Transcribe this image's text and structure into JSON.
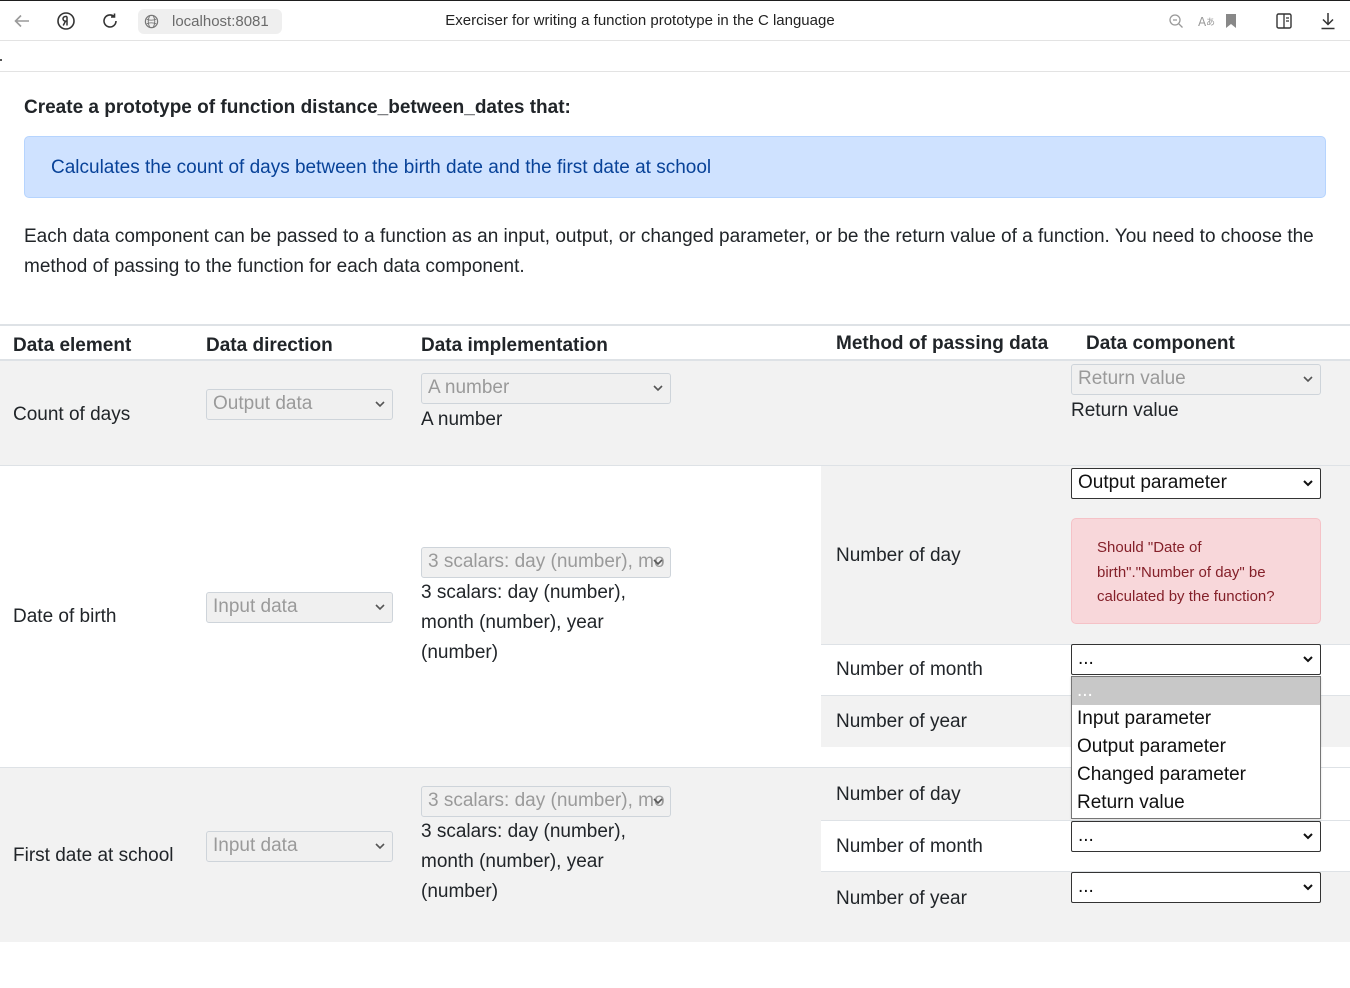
{
  "browser": {
    "url": "localhost:8081",
    "title": "Exerciser for writing a function prototype in the C language"
  },
  "task": {
    "title_prefix": "Create a prototype of function",
    "function_name": "distance_between_dates",
    "title_suffix": "that:",
    "description": "Calculates the count of days between the birth date and the first date at school",
    "explanation": "Each data component can be passed to a function as an input, output, or changed parameter, or be the return value of a function. You need to choose the method of passing to the function for each data component."
  },
  "table": {
    "headers": {
      "element": "Data element",
      "direction": "Data direction",
      "implementation": "Data implementation",
      "method": "Method of passing data",
      "component": "Data component"
    },
    "rows": [
      {
        "element": "Count of days",
        "direction": "Output data",
        "implementation_select": "A number",
        "implementation_text": "A number",
        "components": [
          {
            "name": "",
            "method_select": "Return value",
            "method_text": "Return value"
          }
        ]
      },
      {
        "element": "Date of birth",
        "direction": "Input data",
        "implementation_select": "3 scalars: day (number), month (number), year (number)",
        "implementation_text": "3 scalars: day (number), month (number), year (number)",
        "components": [
          {
            "name": "Number of day",
            "method_select": "Output parameter",
            "error": "Should \"Date of birth\".\"Number of day\" be calculated by the function?"
          },
          {
            "name": "Number of month",
            "method_select": "..."
          },
          {
            "name": "Number of year",
            "method_select": ""
          }
        ]
      },
      {
        "element": "First date at school",
        "direction": "Input data",
        "implementation_select": "3 scalars: day (number), month (number), year (number)",
        "implementation_text": "3 scalars: day (number), month (number), year (number)",
        "components": [
          {
            "name": "Number of day",
            "method_select": ""
          },
          {
            "name": "Number of month",
            "method_select": "..."
          },
          {
            "name": "Number of year",
            "method_select": "..."
          }
        ]
      }
    ],
    "open_dropdown": {
      "options": [
        "...",
        "Input parameter",
        "Output parameter",
        "Changed parameter",
        "Return value"
      ],
      "highlighted": "..."
    }
  },
  "colors": {
    "info_bg": "#cfe2ff",
    "info_text": "#084298",
    "danger_bg": "#f8d7da",
    "danger_text": "#842029",
    "row_alt_bg": "#f2f2f2"
  }
}
